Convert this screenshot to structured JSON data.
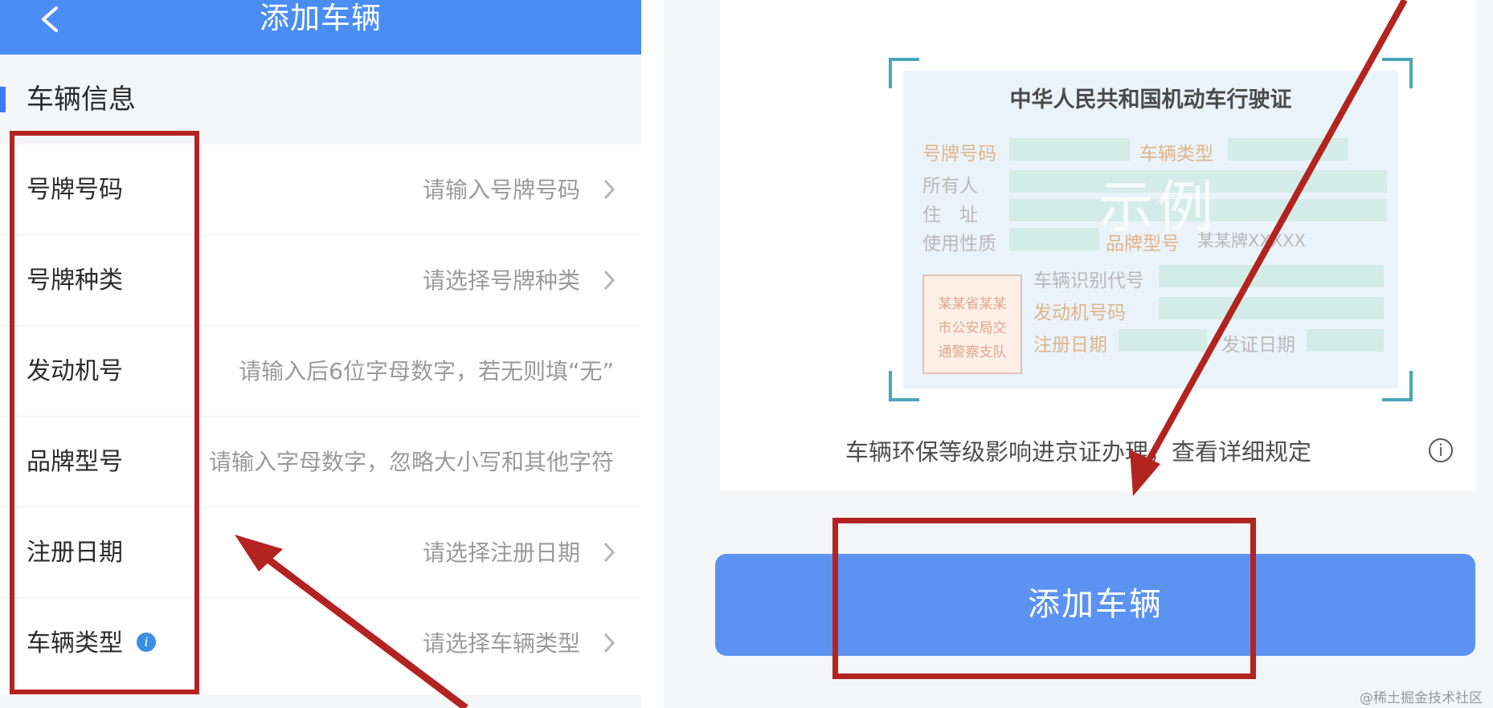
{
  "left": {
    "header": {
      "title": "添加车辆",
      "back_icon": "chevron-left-icon"
    },
    "section_title": "车辆信息",
    "rows": [
      {
        "label": "号牌号码",
        "hint": "请输入号牌号码"
      },
      {
        "label": "号牌种类",
        "hint": "请选择号牌种类"
      },
      {
        "label": "发动机号",
        "hint": "请输入后6位字母数字，若无则填“无”"
      },
      {
        "label": "品牌型号",
        "hint": "请输入字母数字，忽略大小写和其他字符"
      },
      {
        "label": "注册日期",
        "hint": "请选择注册日期"
      },
      {
        "label": "车辆类型",
        "hint": "请选择车辆类型"
      }
    ],
    "info_badge": "i"
  },
  "right": {
    "license": {
      "title": "中华人民共和国机动车行驶证",
      "fields": {
        "plate": "号牌号码",
        "vehicle_type": "车辆类型",
        "owner": "所有人",
        "address": "住　址",
        "usage": "使用性质",
        "brand_model": "品牌型号",
        "brand_sample": "某某牌XXXXX",
        "vin": "车辆识别代号",
        "engine": "发动机号码",
        "reg_date": "注册日期",
        "issue_date": "发证日期"
      },
      "watermark": "示例",
      "stamp": [
        "某某省某某",
        "市公安局交",
        "通警察支队"
      ]
    },
    "env_note": "车辆环保等级影响进京证办理，查看详细规定",
    "env_info_icon": "ⓘ",
    "add_button": "添加车辆"
  },
  "watermark_footer": "@稀土掘金技术社区",
  "colors": {
    "header_blue": "#4a8ef5",
    "button_blue": "#5c93f2",
    "annotation_red": "#b3231f"
  }
}
